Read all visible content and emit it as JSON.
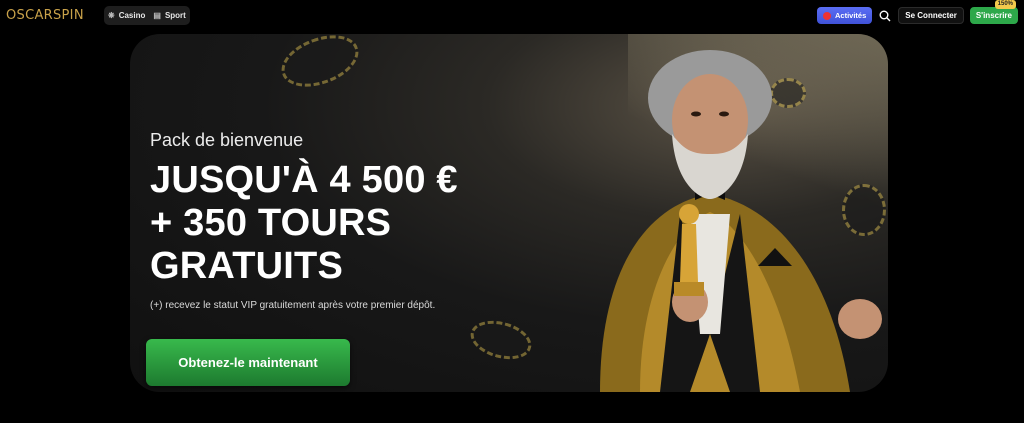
{
  "header": {
    "logo": "OSCARSPIN",
    "nav": [
      {
        "label": "Casino",
        "icon": "casino-icon"
      },
      {
        "label": "Sport",
        "icon": "sport-icon"
      }
    ],
    "activities_label": "Activités",
    "login_label": "Se Connecter",
    "signup_label": "S'inscrire",
    "signup_badge": "150%"
  },
  "banner": {
    "eyebrow": "Pack de bienvenue",
    "headline_line1": "JUSQU'À 4 500 €",
    "headline_line2": "+ 350 TOURS",
    "headline_line3": "GRATUITS",
    "subtitle": "(+) recevez le statut VIP gratuitement après votre premier dépôt.",
    "cta_label": "Obtenez-le maintenant"
  },
  "colors": {
    "accent_green": "#2da84a",
    "activities_blue": "#4a5ef0",
    "logo_gold": "#c9a24a"
  }
}
